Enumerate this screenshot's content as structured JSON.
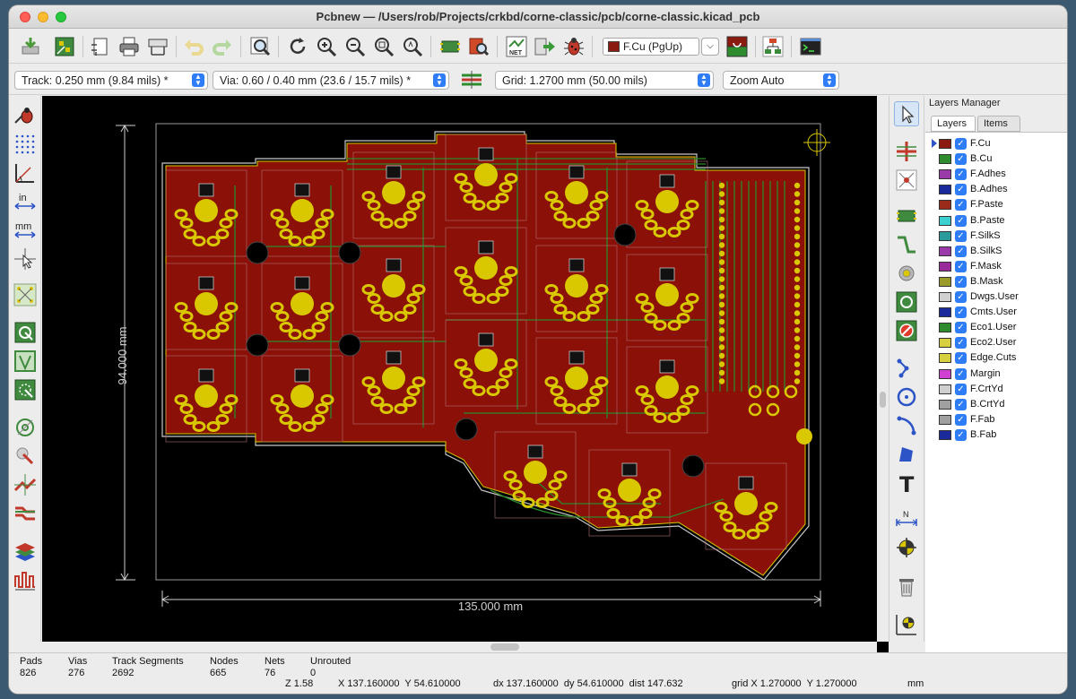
{
  "window": {
    "title": "Pcbnew — /Users/rob/Projects/crkbd/corne-classic/pcb/corne-classic.kicad_pcb"
  },
  "toolbar": {
    "active_layer": "F.Cu (PgUp)",
    "active_layer_color": "#8b1a10",
    "icons": [
      "board-setup-icon",
      "footprint-editor-icon",
      "page-settings-icon",
      "print-icon",
      "plot-icon",
      "undo-icon",
      "redo-icon",
      "find-icon",
      "refresh-icon",
      "zoom-in-icon",
      "zoom-out-icon",
      "zoom-fit-icon",
      "zoom-selection-icon",
      "footprint-browser-icon",
      "library-browser-icon",
      "netlist-icon",
      "update-pcb-icon",
      "drc-bug-icon",
      "layer-pair-icon",
      "hierarchy-icon",
      "scripting-console-icon"
    ]
  },
  "toolbar2": {
    "track": "Track: 0.250 mm (9.84 mils) *",
    "via": "Via: 0.60 / 0.40 mm (23.6 / 15.7 mils) *",
    "grid": "Grid: 1.2700 mm (50.00 mils)",
    "zoom": "Zoom Auto"
  },
  "canvas": {
    "dimension_vertical": "94.000 mm",
    "dimension_horizontal": "135.000 mm",
    "colors": {
      "copper": "#8b1008",
      "pad": "#d9c800",
      "track": "#2a8a2a",
      "edge": "#c8c8c8",
      "background": "#000000"
    }
  },
  "layers_panel": {
    "title": "Layers Manager",
    "tabs": [
      "Layers",
      "Items"
    ],
    "layers": [
      {
        "name": "F.Cu",
        "color": "#8b1a10",
        "active": true
      },
      {
        "name": "B.Cu",
        "color": "#2e8b2e"
      },
      {
        "name": "F.Adhes",
        "color": "#9a3aa8"
      },
      {
        "name": "B.Adhes",
        "color": "#1a2a9a"
      },
      {
        "name": "F.Paste",
        "color": "#9a2a1a"
      },
      {
        "name": "B.Paste",
        "color": "#3ad0d0"
      },
      {
        "name": "F.SilkS",
        "color": "#2a9a9a"
      },
      {
        "name": "B.SilkS",
        "color": "#9a3aa8"
      },
      {
        "name": "F.Mask",
        "color": "#9a2a9a"
      },
      {
        "name": "B.Mask",
        "color": "#9a9a2a"
      },
      {
        "name": "Dwgs.User",
        "color": "#d0d0d0"
      },
      {
        "name": "Cmts.User",
        "color": "#1a2a9a"
      },
      {
        "name": "Eco1.User",
        "color": "#2e8b2e"
      },
      {
        "name": "Eco2.User",
        "color": "#d6d040"
      },
      {
        "name": "Edge.Cuts",
        "color": "#d6d040"
      },
      {
        "name": "Margin",
        "color": "#d040d0"
      },
      {
        "name": "F.CrtYd",
        "color": "#d0d0d0"
      },
      {
        "name": "B.CrtYd",
        "color": "#a0a0a0"
      },
      {
        "name": "F.Fab",
        "color": "#a0a0a0"
      },
      {
        "name": "B.Fab",
        "color": "#1a2a9a"
      }
    ]
  },
  "status": {
    "labels": {
      "pads": "Pads",
      "vias": "Vias",
      "tracks": "Track Segments",
      "nodes": "Nodes",
      "nets": "Nets",
      "unrouted": "Unrouted"
    },
    "values": {
      "pads": "826",
      "vias": "276",
      "tracks": "2692",
      "nodes": "665",
      "nets": "76",
      "unrouted": "0"
    },
    "zoom": "Z 1.58",
    "xy": "X 137.160000  Y 54.610000",
    "delta": "dx 137.160000  dy 54.610000  dist 147.632",
    "grid": "grid X 1.270000  Y 1.270000",
    "units": "mm"
  }
}
